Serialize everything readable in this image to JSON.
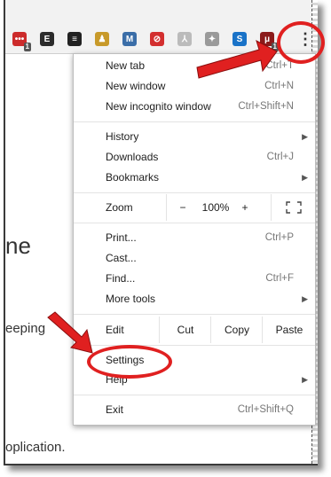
{
  "toolbar": {
    "extensions": [
      {
        "name": "lastpass-icon",
        "color": "#cc2b2b",
        "glyph": "•••",
        "badge": "1"
      },
      {
        "name": "evernote-icon",
        "color": "#2b2b2b",
        "glyph": "E",
        "badge": ""
      },
      {
        "name": "buffer-icon",
        "color": "#222222",
        "glyph": "≡",
        "badge": ""
      },
      {
        "name": "user-lock-icon",
        "color": "#c89a2a",
        "glyph": "♟",
        "badge": ""
      },
      {
        "name": "mailtrack-icon",
        "color": "#3b6ea8",
        "glyph": "M",
        "badge": ""
      },
      {
        "name": "adblock-icon",
        "color": "#d32f2f",
        "glyph": "⊘",
        "badge": ""
      },
      {
        "name": "acrobat-icon",
        "color": "#bbbbbb",
        "glyph": "⅄",
        "badge": ""
      },
      {
        "name": "extension-icon",
        "color": "#9a9a9a",
        "glyph": "✦",
        "badge": ""
      },
      {
        "name": "skype-icon",
        "color": "#1a73c8",
        "glyph": "S",
        "badge": ""
      },
      {
        "name": "ublock-icon",
        "color": "#8b1a1a",
        "glyph": "μ",
        "badge": "1"
      }
    ],
    "menu_button_glyph": "⋮"
  },
  "page_fragments": {
    "heading": "ne",
    "line1": "eeping",
    "line2": "oplication."
  },
  "menu": {
    "group1": [
      {
        "label": "New tab",
        "shortcut": "Ctrl+T"
      },
      {
        "label": "New window",
        "shortcut": "Ctrl+N"
      },
      {
        "label": "New incognito window",
        "shortcut": "Ctrl+Shift+N"
      }
    ],
    "group2": [
      {
        "label": "History",
        "shortcut": "",
        "arrow": "▶"
      },
      {
        "label": "Downloads",
        "shortcut": "Ctrl+J"
      },
      {
        "label": "Bookmarks",
        "shortcut": "",
        "arrow": "▶"
      }
    ],
    "zoom": {
      "label": "Zoom",
      "minus": "−",
      "value": "100%",
      "plus": "+"
    },
    "group3": [
      {
        "label": "Print...",
        "shortcut": "Ctrl+P"
      },
      {
        "label": "Cast...",
        "shortcut": ""
      },
      {
        "label": "Find...",
        "shortcut": "Ctrl+F"
      },
      {
        "label": "More tools",
        "shortcut": "",
        "arrow": "▶"
      }
    ],
    "edit": {
      "label": "Edit",
      "cut": "Cut",
      "copy": "Copy",
      "paste": "Paste"
    },
    "group4": [
      {
        "label": "Settings",
        "shortcut": ""
      },
      {
        "label": "Help",
        "shortcut": "",
        "arrow": "▶"
      }
    ],
    "exit": {
      "label": "Exit",
      "shortcut": "Ctrl+Shift+Q"
    }
  },
  "colors": {
    "annotation_red": "#e02020",
    "menu_text": "#202020",
    "shortcut_text": "#777777"
  }
}
